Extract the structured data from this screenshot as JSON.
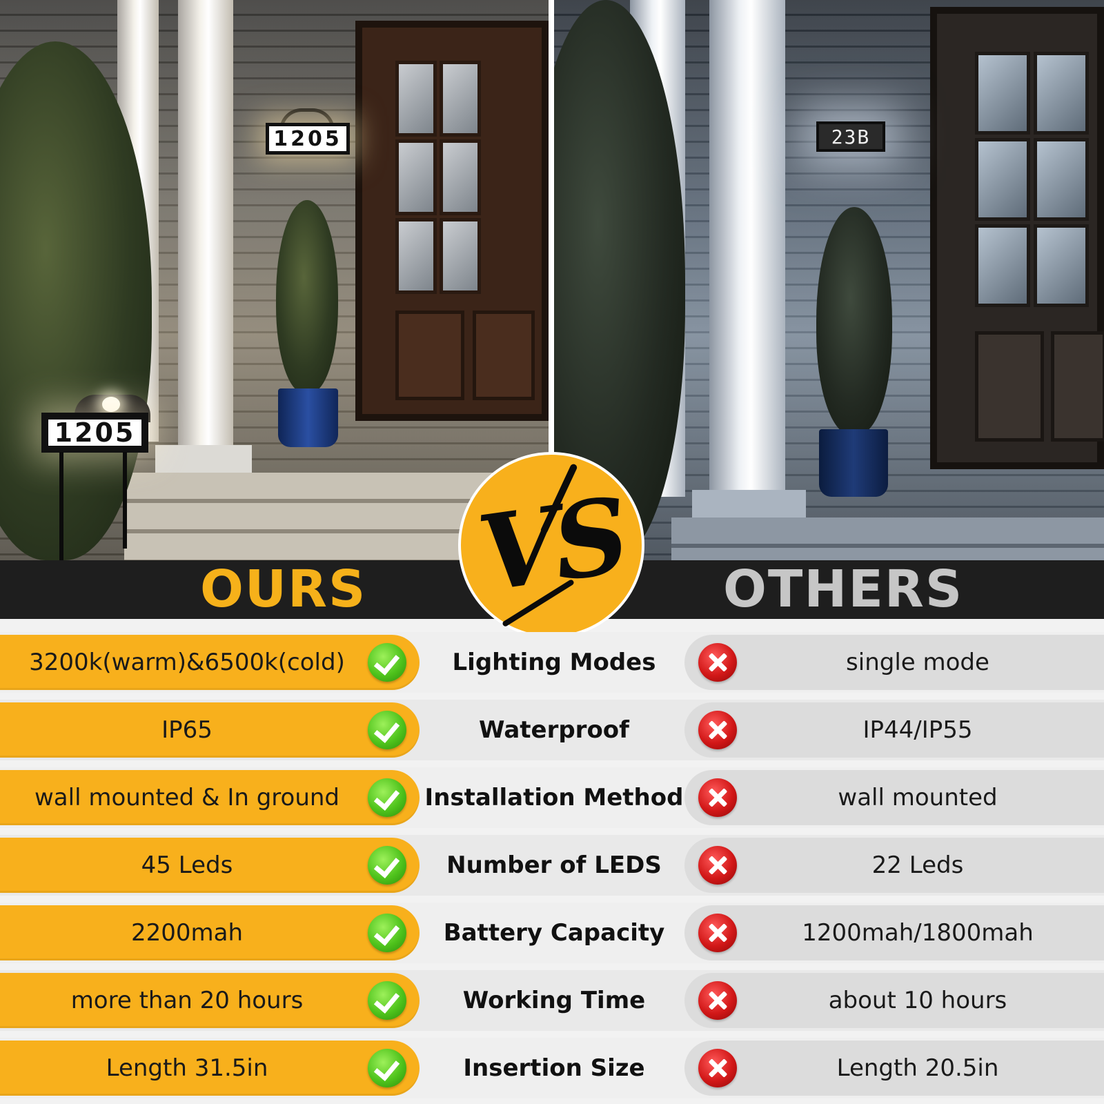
{
  "photos": {
    "ours_wall_number": "1205",
    "ours_ground_number": "1205",
    "others_wall_number": "23B"
  },
  "banner": {
    "ours_label": "OURS",
    "vs_label": "VS",
    "others_label": "OTHERS"
  },
  "colors": {
    "ours_accent": "#f8b01c",
    "others_pill": "#dcdcdc",
    "check_green": "#4fc31c",
    "cross_red": "#d21818",
    "banner_bg": "#1e1e1e"
  },
  "icons": {
    "ours_status": "check-icon",
    "others_status": "cross-icon"
  },
  "rows": [
    {
      "ours": "3200k(warm)&6500k(cold)",
      "feature": "Lighting Modes",
      "others": "single mode"
    },
    {
      "ours": "IP65",
      "feature": "Waterproof",
      "others": "IP44/IP55"
    },
    {
      "ours": "wall mounted & In ground",
      "feature": "Installation Method",
      "others": "wall mounted"
    },
    {
      "ours": "45 Leds",
      "feature": "Number of LEDS",
      "others": "22 Leds"
    },
    {
      "ours": "2200mah",
      "feature": "Battery Capacity",
      "others": "1200mah/1800mah"
    },
    {
      "ours": "more than 20 hours",
      "feature": "Working Time",
      "others": "about 10 hours"
    },
    {
      "ours": "Length 31.5in",
      "feature": "Insertion Size",
      "others": "Length 20.5in"
    }
  ]
}
